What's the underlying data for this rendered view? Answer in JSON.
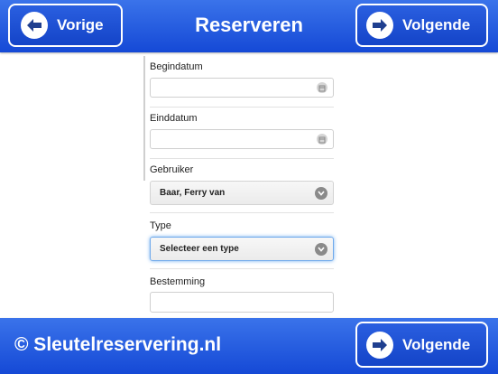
{
  "header": {
    "title": "Reserveren",
    "prev_label": "Vorige",
    "next_label": "Volgende"
  },
  "form": {
    "begindatum": {
      "label": "Begindatum",
      "value": ""
    },
    "einddatum": {
      "label": "Einddatum",
      "value": ""
    },
    "gebruiker": {
      "label": "Gebruiker",
      "value": "Baar, Ferry van"
    },
    "type": {
      "label": "Type",
      "value": "Selecteer een type"
    },
    "bestemming": {
      "label": "Bestemming",
      "value": ""
    }
  },
  "footer": {
    "copyright": "© Sleutelreservering.nl",
    "next_label": "Volgende"
  },
  "colors": {
    "bar": "#1f55dc",
    "focus": "#6ea9ec"
  }
}
